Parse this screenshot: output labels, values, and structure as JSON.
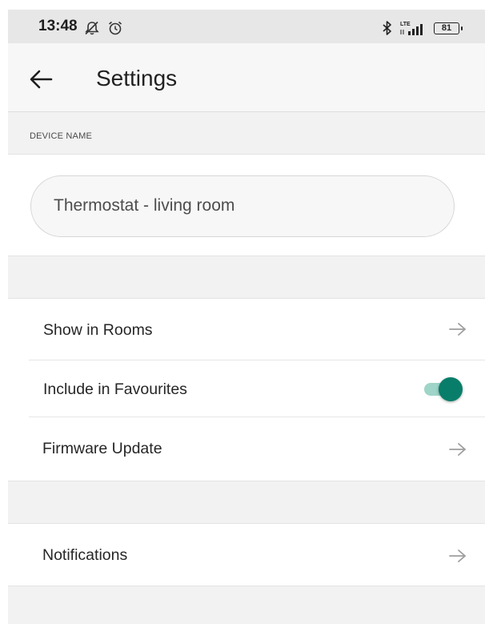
{
  "status_bar": {
    "time": "13:48",
    "battery": "81",
    "network": "LTE",
    "icons": [
      "notifications-off-icon",
      "alarm-icon",
      "bluetooth-icon",
      "signal-icon",
      "battery-icon"
    ]
  },
  "app_bar": {
    "title": "Settings",
    "back_icon": "arrow-back-icon"
  },
  "device_name_section": {
    "header": "DEVICE NAME",
    "value": "Thermostat - living room"
  },
  "settings_list": {
    "items": [
      {
        "label": "Show in Rooms",
        "control": "arrow-forward-icon"
      },
      {
        "label": "Include in Favourites",
        "control": "toggle",
        "enabled": true
      },
      {
        "label": "Firmware Update",
        "control": "arrow-forward-icon"
      }
    ]
  },
  "notifications_list": {
    "items": [
      {
        "label": "Notifications",
        "control": "arrow-forward-icon"
      }
    ]
  },
  "colors": {
    "accent": "#087e6a",
    "accent_track": "#9fd4c8",
    "background": "#f2f2f2",
    "card": "#ffffff",
    "arrow": "#9e9e9e"
  }
}
